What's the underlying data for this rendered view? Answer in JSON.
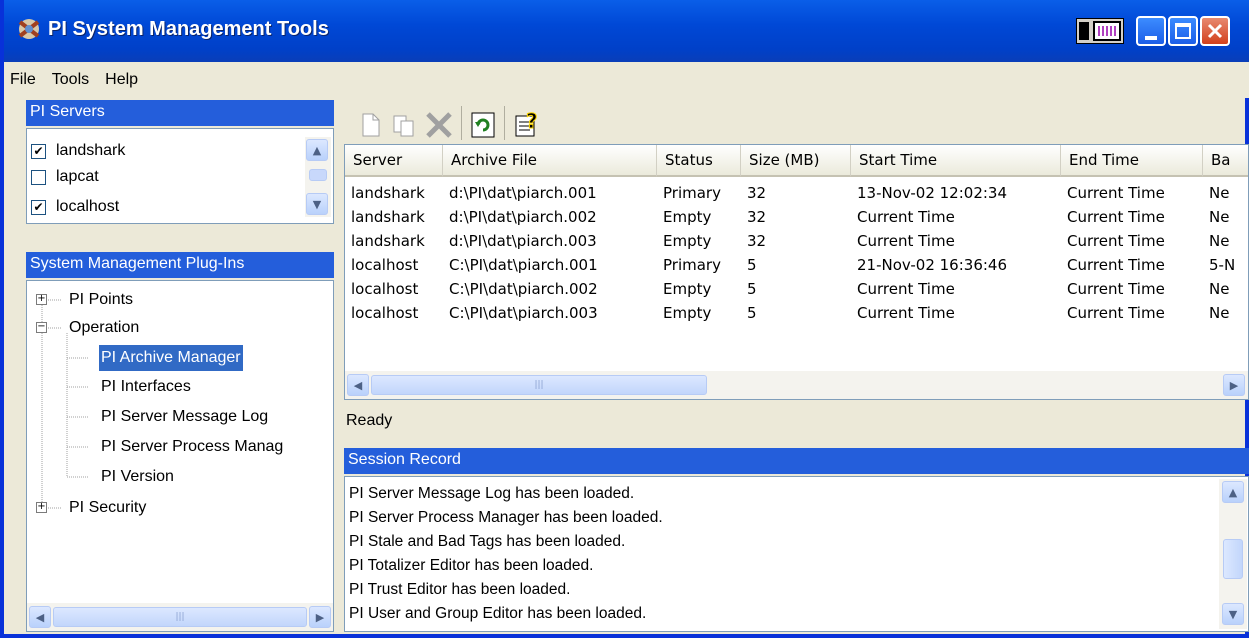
{
  "window": {
    "title": "PI System Management Tools"
  },
  "menu": [
    "File",
    "Tools",
    "Help"
  ],
  "servers_pane": {
    "title": "PI Servers",
    "items": [
      {
        "label": "landshark",
        "checked": true
      },
      {
        "label": "lapcat",
        "checked": false
      },
      {
        "label": "localhost",
        "checked": true
      }
    ]
  },
  "plugins_pane": {
    "title": "System Management Plug-Ins",
    "tree": [
      {
        "label": "PI Points",
        "expander": "+"
      },
      {
        "label": "Operation",
        "expander": "−"
      },
      {
        "label": "PI Archive Manager",
        "selected": true
      },
      {
        "label": "PI Interfaces"
      },
      {
        "label": "PI Server Message Log"
      },
      {
        "label": "PI Server Process Manag"
      },
      {
        "label": "PI Version"
      },
      {
        "label": "PI Security",
        "expander": "+"
      }
    ]
  },
  "toolbar": {
    "icons": [
      "new-icon",
      "copy-icon",
      "delete-icon",
      "refresh-icon",
      "properties-icon"
    ]
  },
  "archive_table": {
    "columns": [
      "Server",
      "Archive File",
      "Status",
      "Size (MB)",
      "Start Time",
      "End Time",
      "Ba"
    ],
    "rows": [
      [
        "landshark",
        "d:\\PI\\dat\\piarch.001",
        "Primary",
        "32",
        "13-Nov-02 12:02:34",
        "Current Time",
        "Ne"
      ],
      [
        "landshark",
        "d:\\PI\\dat\\piarch.002",
        "Empty",
        "32",
        "Current Time",
        "Current Time",
        "Ne"
      ],
      [
        "landshark",
        "d:\\PI\\dat\\piarch.003",
        "Empty",
        "32",
        "Current Time",
        "Current Time",
        "Ne"
      ],
      [
        "localhost",
        "C:\\PI\\dat\\piarch.001",
        "Primary",
        "5",
        "21-Nov-02 16:36:46",
        "Current Time",
        "5-N"
      ],
      [
        "localhost",
        "C:\\PI\\dat\\piarch.002",
        "Empty",
        "5",
        "Current Time",
        "Current Time",
        "Ne"
      ],
      [
        "localhost",
        "C:\\PI\\dat\\piarch.003",
        "Empty",
        "5",
        "Current Time",
        "Current Time",
        "Ne"
      ]
    ]
  },
  "status": {
    "text": "Ready"
  },
  "session": {
    "title": "Session Record",
    "lines": [
      "PI Server Message Log has been loaded.",
      "PI Server Process Manager has been loaded.",
      "PI Stale and Bad Tags has been loaded.",
      "PI Totalizer Editor has been loaded.",
      "PI Trust Editor has been loaded.",
      "PI User and Group Editor has been loaded."
    ]
  }
}
